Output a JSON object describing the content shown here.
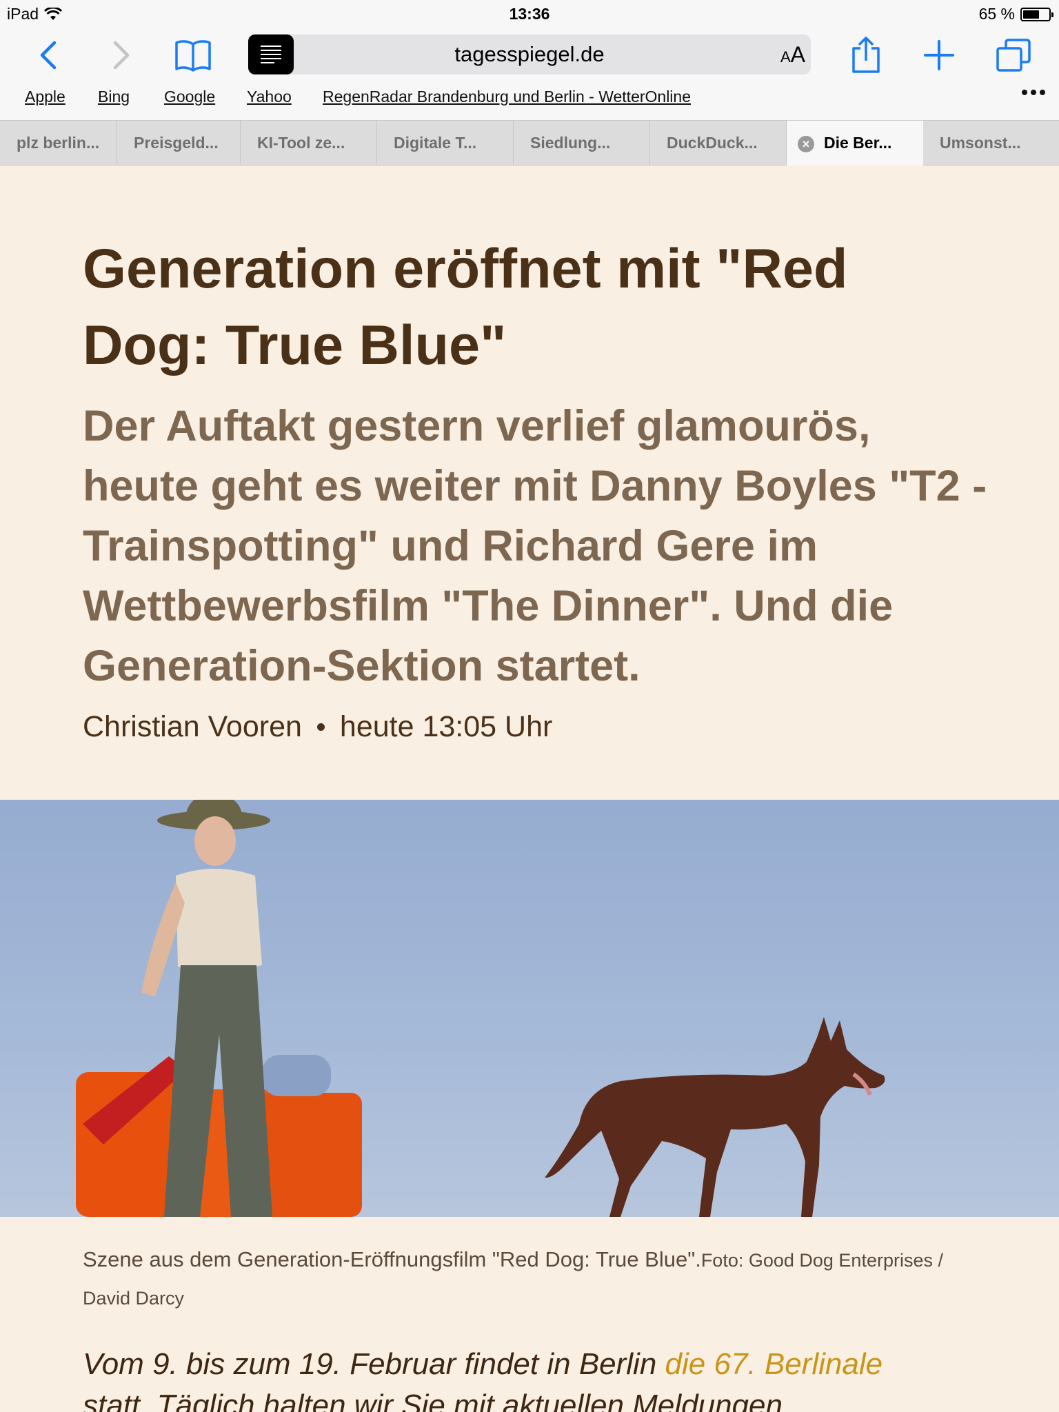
{
  "status": {
    "device": "iPad",
    "time": "13:36",
    "battery": "65 %",
    "battery_level": 0.65
  },
  "toolbar": {
    "url": "tagesspiegel.de",
    "aa_label_small": "A",
    "aa_label_big": "A"
  },
  "favorites": [
    "Apple",
    "Bing",
    "Google",
    "Yahoo",
    "RegenRadar Brandenburg und Berlin - WetterOnline"
  ],
  "tabs": [
    "plz berlin...",
    "Preisgeld...",
    "KI-Tool ze...",
    "Digitale T...",
    "Siedlung...",
    "DuckDuck...",
    "Die Ber...",
    "Umsonst..."
  ],
  "article": {
    "headline": "Generation eröffnet mit \"Red Dog: True Blue\"",
    "teaser": "Der Auftakt gestern verlief glamourös, heute geht es weiter mit Danny Boyles \"T2 - Trainspotting\" und Richard Gere im Wettbewerbsfilm \"The Dinner\". Und die Generation-Sektion startet.",
    "author": "Christian Vooren",
    "published": "heute 13:05 Uhr",
    "caption": "Szene aus dem Generation-Eröffnungsfilm \"Red Dog: True Blue\".",
    "credit": "Foto: Good Dog Enterprises / David Darcy",
    "lead_start": "Vom 9. bis zum 19. Februar findet in Berlin ",
    "lead_link": "die 67. Berlinale",
    "lead_line2": "statt. Täglich halten wir Sie mit aktuellen Meldungen"
  },
  "colors": {
    "accent_blue": "#1a7cf5",
    "page_background": "#f9f0e3",
    "headline": "#4b3018",
    "teaser": "#7e6750",
    "link": "#c99417"
  }
}
